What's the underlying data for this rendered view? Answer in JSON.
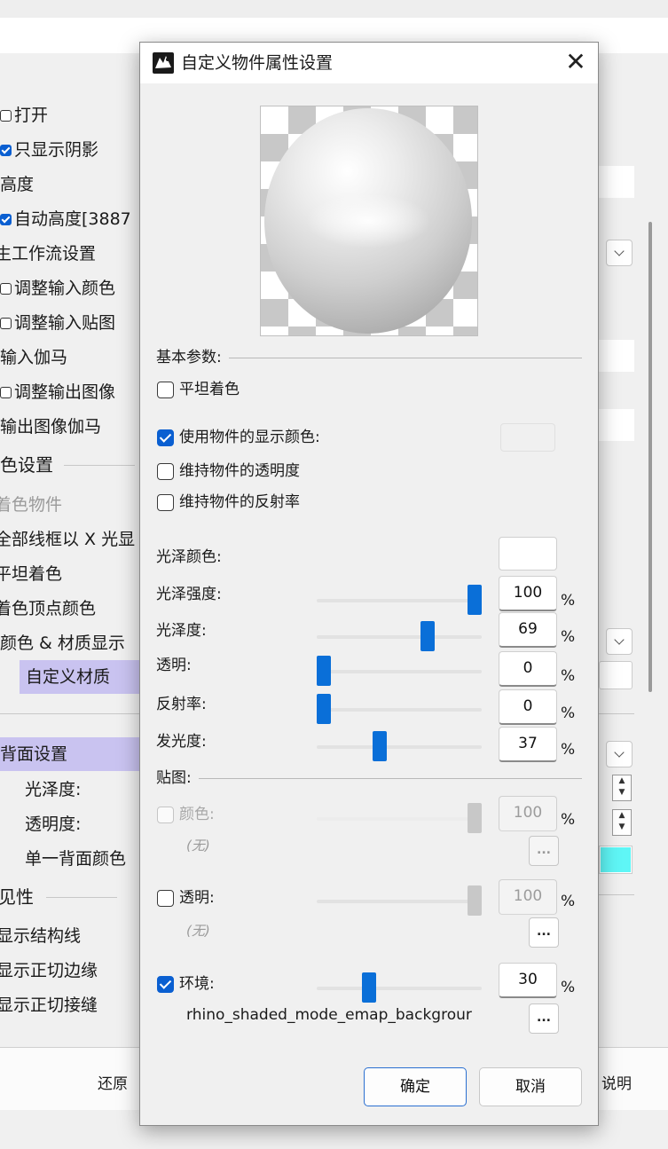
{
  "background_window": {
    "items": [
      {
        "label": "打开",
        "checkbox": "off"
      },
      {
        "label": "只显示阴影",
        "checkbox": "on"
      },
      {
        "label": "高度"
      },
      {
        "label": "自动高度[3887",
        "checkbox": "on"
      },
      {
        "label": "生工作流设置"
      },
      {
        "label": "调整输入颜色",
        "checkbox": "off"
      },
      {
        "label": "调整输入贴图",
        "checkbox": "off"
      },
      {
        "label": "输入伽马"
      },
      {
        "label": "调整输出图像",
        "checkbox": "off"
      },
      {
        "label": "输出图像伽马"
      },
      {
        "label": "色设置"
      },
      {
        "label": "着色物件"
      },
      {
        "label": "全部线框以 X 光显"
      },
      {
        "label": "平坦着色"
      },
      {
        "label": "着色顶点颜色"
      },
      {
        "label": "颜色 & 材质显示"
      },
      {
        "label": "自定义材质"
      },
      {
        "label": "背面设置"
      },
      {
        "label": "光泽度:"
      },
      {
        "label": "透明度:"
      },
      {
        "label": "单一背面颜色"
      },
      {
        "label": "见性"
      },
      {
        "label": "显示结构线"
      },
      {
        "label": "显示正切边缘"
      },
      {
        "label": "显示正切接缝"
      }
    ],
    "bottom_left_button": "还原",
    "bottom_right_button": "说明",
    "accent_color": "#5ff6f6",
    "highlight_color": "#c9c3f0"
  },
  "dialog": {
    "title": "自定义物件属性设置",
    "close_glyph": "✕",
    "basic_section": "基本参数:",
    "flat_shading": {
      "label": "平坦着色",
      "checked": false
    },
    "use_object_color": {
      "label": "使用物件的显示颜色:",
      "checked": true
    },
    "keep_transparency": {
      "label": "维持物件的透明度",
      "checked": false
    },
    "keep_reflectivity": {
      "label": "维持物件的反射率",
      "checked": false
    },
    "gloss_color_label": "光泽颜色:",
    "sliders": [
      {
        "label": "光泽强度:",
        "value": "100",
        "unit": "%",
        "fraction": 1.0
      },
      {
        "label": "光泽度:",
        "value": "69",
        "unit": "%",
        "fraction": 0.69
      },
      {
        "label": "透明:",
        "value": "0",
        "unit": "%",
        "fraction": 0.0
      },
      {
        "label": "反射率:",
        "value": "0",
        "unit": "%",
        "fraction": 0.0
      },
      {
        "label": "发光度:",
        "value": "37",
        "unit": "%",
        "fraction": 0.37
      }
    ],
    "textures_section": "贴图:",
    "tex_color": {
      "label": "颜色:",
      "checked": false,
      "enabled": false,
      "value": "100",
      "unit": "%",
      "fraction": 1.0,
      "none_text": "(无)",
      "browse": "..."
    },
    "tex_transparency": {
      "label": "透明:",
      "checked": false,
      "enabled": true,
      "value": "100",
      "unit": "%",
      "fraction": 1.0,
      "none_text": "(无)",
      "browse": "..."
    },
    "tex_environment": {
      "label": "环境:",
      "checked": true,
      "enabled": true,
      "value": "30",
      "unit": "%",
      "fraction": 0.3,
      "file": "rhino_shaded_mode_emap_backgrour",
      "browse": "..."
    },
    "ok_button": "确定",
    "cancel_button": "取消",
    "accent_color": "#0a6fd8"
  }
}
